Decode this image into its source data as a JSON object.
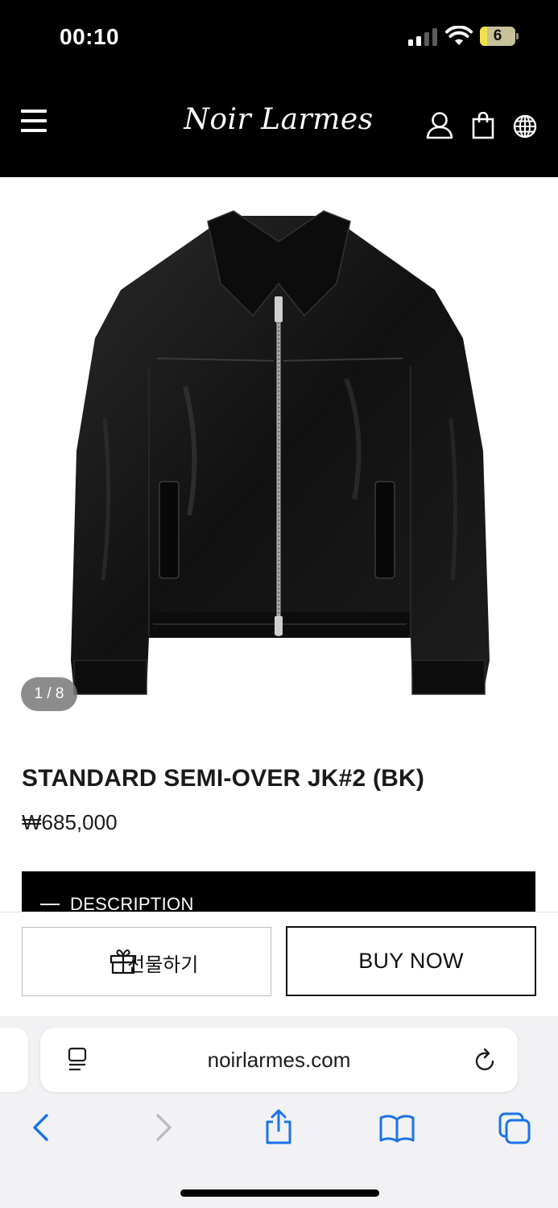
{
  "status_bar": {
    "time": "00:10",
    "battery_level": "6",
    "signal_bars_active": 2,
    "signal_bars_total": 4
  },
  "header": {
    "logo": "Noir Larmes",
    "icons": [
      "menu-icon",
      "account-icon",
      "shopping-bag-icon",
      "globe-icon"
    ]
  },
  "gallery": {
    "counter": "1 / 8",
    "image_description_icon": "black-leather-jacket-image"
  },
  "product": {
    "title": "STANDARD SEMI-OVER JK#2 (BK)",
    "price": "₩685,000"
  },
  "accordion": {
    "description_label": "DESCRIPTION"
  },
  "actions": {
    "gift_label": "선물하기",
    "buy_label": "BUY NOW"
  },
  "browser": {
    "url": "noirlarmes.com",
    "toolbar_icons": [
      "back-icon",
      "forward-icon",
      "share-icon",
      "bookmarks-icon",
      "tabs-icon"
    ]
  },
  "colors": {
    "header_bg": "#000000",
    "accent_link": "#1a73e8",
    "safari_bg": "#f2f2f4"
  }
}
